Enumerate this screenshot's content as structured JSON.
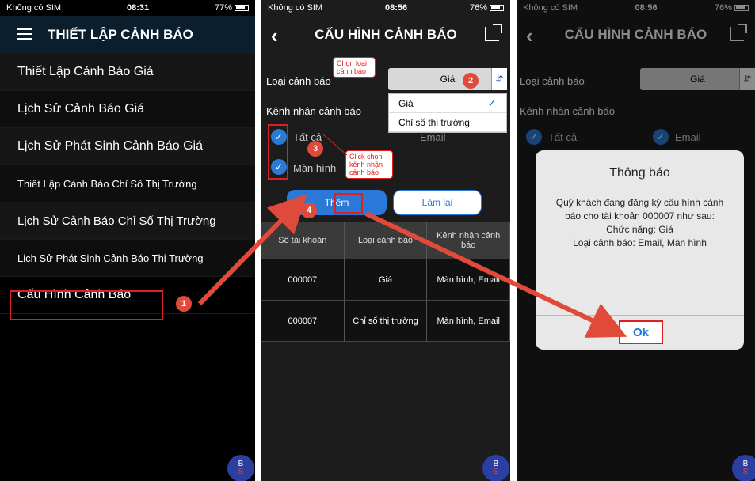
{
  "screen1": {
    "status": {
      "carrier": "Không có SIM",
      "time": "08:31",
      "battery": "77%"
    },
    "title": "THIẾT LẬP CẢNH BÁO",
    "menu": [
      "Thiết Lập Cảnh Báo Giá",
      "Lịch Sử Cảnh Báo Giá",
      "Lịch Sử Phát Sinh Cảnh Báo Giá",
      "Thiết Lập Cảnh Báo Chỉ Số Thị Trường",
      "Lịch Sử Cảnh Báo Chỉ Số  Thị Trường",
      "Lịch Sử Phát Sinh Cảnh Báo Thị Trường",
      "Cấu Hình Cảnh Báo"
    ],
    "step_badge": "1",
    "bs_top": "B",
    "bs_bottom": "S"
  },
  "screen2": {
    "status": {
      "carrier": "Không có SIM",
      "time": "08:56",
      "battery": "76%"
    },
    "title": "CẤU HÌNH CẢNH BÁO",
    "alert_type_label": "Loại cảnh báo",
    "alert_type_value": "Giá",
    "channel_label": "Kênh nhận cảnh báo",
    "dropdown_options": [
      "Giá",
      "Chỉ số  thị trường"
    ],
    "chk_all": "Tất cả",
    "chk_email": "Email",
    "chk_screen": "Màn hình",
    "callout_1": "Chọn loại cảnh báo",
    "callout_2": "Click chọn kênh nhận cảnh báo",
    "btn_add": "Thêm",
    "btn_reset": "Làm lại",
    "badges": [
      "2",
      "3",
      "4"
    ],
    "table": {
      "headers": [
        "Số tài khoản",
        "Loại cảnh báo",
        "Kênh nhận cảnh báo"
      ],
      "rows": [
        [
          "000007",
          "Giá",
          "Màn hình, Email"
        ],
        [
          "000007",
          "Chỉ số  thị trường",
          "Màn hình, Email"
        ]
      ]
    },
    "bs_top": "B",
    "bs_bottom": "S"
  },
  "screen3": {
    "status": {
      "carrier": "Không có SIM",
      "time": "08:56",
      "battery": "76%"
    },
    "title": "CẤU HÌNH CẢNH BÁO",
    "alert_type_label": "Loại cảnh báo",
    "alert_type_value": "Giá",
    "channel_label": "Kênh nhận cảnh báo",
    "chk_all": "Tất cả",
    "chk_email": "Email",
    "dialog": {
      "title": "Thông báo",
      "line1": "Quý khách đang đăng ký cấu hình cảnh báo cho tài khoản 000007 như sau:",
      "line2": "Chức năng: Giá",
      "line3": "Loại cảnh báo: Email, Màn hình",
      "ok": "Ok"
    },
    "bs_top": "B",
    "bs_bottom": "S"
  },
  "colors": {
    "accent": "#2a78d8",
    "annotation": "#e02020",
    "badge": "#e04a3a"
  }
}
